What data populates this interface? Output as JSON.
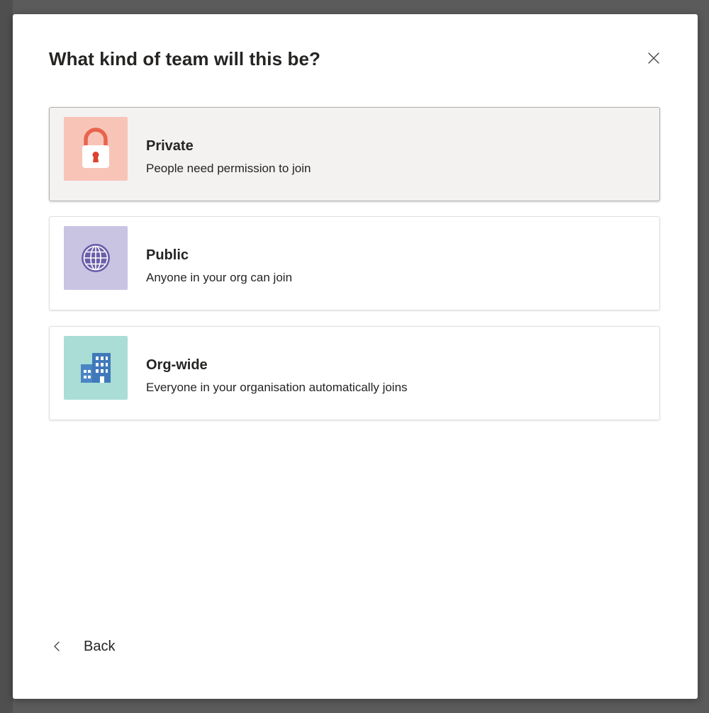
{
  "dialog": {
    "title": "What kind of team will this be?",
    "close_icon": "close-icon"
  },
  "options": [
    {
      "title": "Private",
      "description": "People need permission to join",
      "icon": "lock-icon",
      "icon_bg": "#f8c4b8",
      "icon_color": "#e8644c",
      "selected": true
    },
    {
      "title": "Public",
      "description": "Anyone in your org can join",
      "icon": "globe-icon",
      "icon_bg": "#c9c4e2",
      "icon_color": "#6a5faa",
      "selected": false
    },
    {
      "title": "Org-wide",
      "description": "Everyone in your organisation automatically joins",
      "icon": "building-icon",
      "icon_bg": "#a9ddd6",
      "icon_color": "#4b86c4",
      "selected": false
    }
  ],
  "footer": {
    "back_label": "Back",
    "back_icon": "chevron-left-icon"
  }
}
